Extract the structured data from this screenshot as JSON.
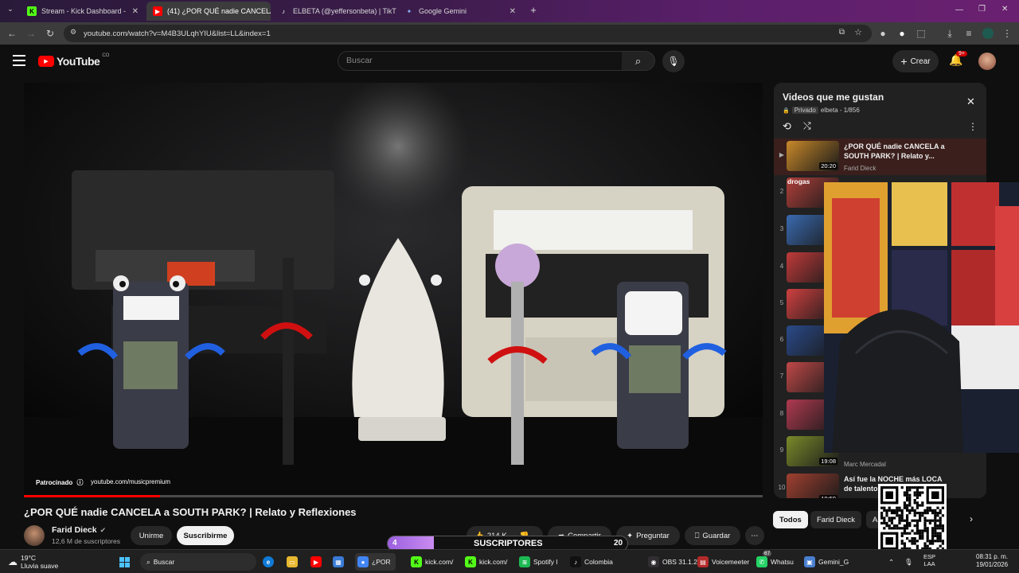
{
  "tabs": [
    {
      "label": "Stream - Kick Dashboard -",
      "icon": "kick-icon",
      "color": "#53fc18",
      "close": "✕"
    },
    {
      "label": "(41) ¿POR QUÉ nadie CANCELA",
      "icon": "youtube-icon",
      "color": "#ff0000",
      "close": "✕"
    },
    {
      "label": "ELBETA (@yeffersonbeta) | TikT",
      "icon": "tiktok-icon",
      "color": "#ffffff",
      "close": "✕"
    },
    {
      "label": "Google Gemini",
      "icon": "gemini-icon",
      "color": "#8ab4f8",
      "close": "✕"
    }
  ],
  "new_tab": "+",
  "address": "youtube.com/watch?v=M4B3ULqhYIU&list=LL&index=1",
  "youtube": {
    "logo": "YouTube",
    "country": "CO",
    "search_placeholder": "Buscar",
    "create_label": "Crear",
    "notif_count": "9+"
  },
  "video": {
    "title": "¿POR QUÉ nadie CANCELA a SOUTH PARK? | Relato y Reflexiones",
    "sponsor_label": "Patrocinado",
    "sponsor_url": "youtube.com/musicpremium",
    "progress_fraction": 0.184
  },
  "channel": {
    "name": "Farid Dieck",
    "subscribers": "12,6 M de suscriptores",
    "join": "Unirme",
    "subscribe": "Suscribirme"
  },
  "actions": {
    "likes": "214 K",
    "share": "Compartir",
    "ask": "Preguntar",
    "save": "Guardar"
  },
  "playlist": {
    "title": "Videos que me gustan",
    "privacy": "Privado",
    "owner_count": "elbeta - 1/856",
    "items": [
      {
        "num": "▶",
        "title": "¿POR QUÉ nadie CANCELA a SOUTH PARK? | Relato y...",
        "channel": "Farid Dieck",
        "time": "20:20",
        "thumb": "#c9892a"
      },
      {
        "num": "2",
        "title": "",
        "channel": "",
        "time": "3",
        "thumb": "#b0403a"
      },
      {
        "num": "3",
        "title": "",
        "channel": "",
        "time": "3",
        "thumb": "#3a6ab0"
      },
      {
        "num": "4",
        "title": "",
        "channel": "",
        "time": "",
        "thumb": "#c03a3a"
      },
      {
        "num": "5",
        "title": "",
        "channel": "",
        "time": "",
        "thumb": "#d04040"
      },
      {
        "num": "6",
        "title": "",
        "channel": "",
        "time": "",
        "thumb": "#2a4a8a"
      },
      {
        "num": "7",
        "title": "",
        "channel": "",
        "time": "4",
        "thumb": "#c04848"
      },
      {
        "num": "8",
        "title": "",
        "channel": "",
        "time": "",
        "thumb": "#b03a50"
      },
      {
        "num": "9",
        "title": "",
        "channel": "Marc Mercadal",
        "time": "19:08",
        "thumb": "#7a8a2a"
      },
      {
        "num": "10",
        "title": "Así fue la NOCHE más LOCA de talentos",
        "channel": "",
        "time": "10:59",
        "thumb": "#a04030"
      }
    ],
    "item2_overlay": "drogas"
  },
  "chips": [
    "Todos",
    "Farid Dieck",
    "A"
  ],
  "subs_bar": {
    "left": "4",
    "label": "SUSCRIPTORES",
    "right": "20"
  },
  "taskbar": {
    "weather_temp": "19°C",
    "weather_desc": "Lluvia suave",
    "search": "Buscar",
    "apps": [
      {
        "label": "¿POR",
        "icon": "chrome-icon",
        "color": "#4285f4"
      },
      {
        "label": "kick.com/",
        "icon": "kick-icon",
        "color": "#53fc18"
      },
      {
        "label": "kick.com/",
        "icon": "kick-icon",
        "color": "#53fc18"
      },
      {
        "label": "Spotify I",
        "icon": "spotify-icon",
        "color": "#1db954"
      },
      {
        "label": "Colombia",
        "icon": "tiktok-icon",
        "color": "#111111"
      },
      {
        "label": "OBS 31.1.2",
        "icon": "obs-icon",
        "color": "#302e31"
      },
      {
        "label": "Voicemeeter",
        "icon": "voicemeeter-icon",
        "color": "#b42a2a"
      },
      {
        "label": "Whatsu",
        "icon": "whatsapp-icon",
        "color": "#25d366"
      },
      {
        "label": "Gemini_G",
        "icon": "gemini-icon",
        "color": "#4a7fd0"
      }
    ],
    "whatsapp_badge": "67",
    "lang": "ESP",
    "lang2": "LAA",
    "time": "08:31 p. m.",
    "date": "19/01/2026"
  }
}
